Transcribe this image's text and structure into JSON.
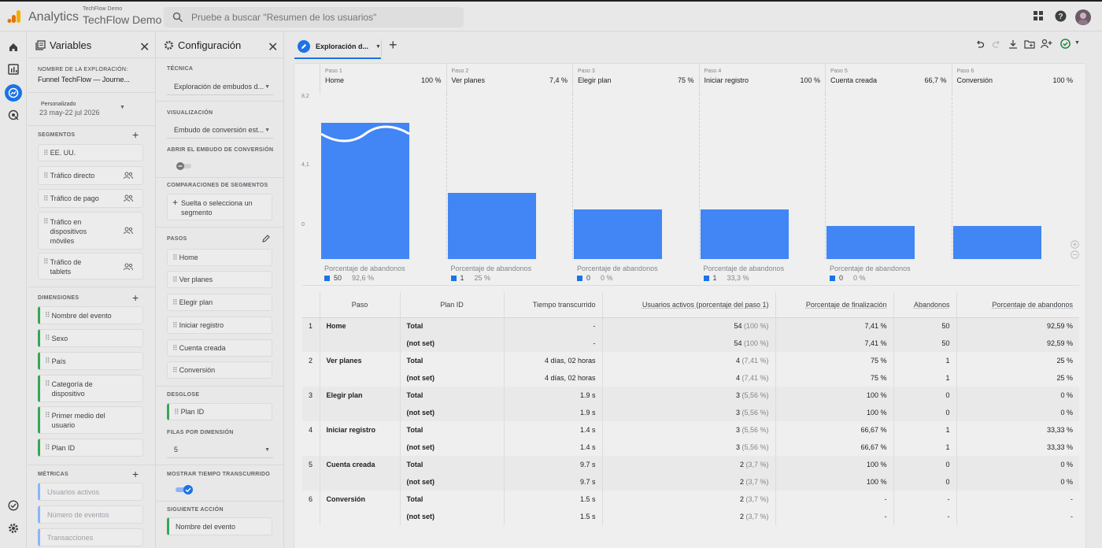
{
  "app": {
    "name": "Analytics",
    "account_sub": "TechFlow Demo",
    "account_main": "TechFlow Demo",
    "search_placeholder": "Pruebe a buscar \"Resumen de los usuarios\""
  },
  "variables": {
    "title": "Variables",
    "exploration_name_label": "NOMBRE DE LA EXPLORACIÓN:",
    "exploration_name": "Funnel TechFlow — Journe...",
    "date_label": "Personalizado",
    "date_range": "23 may-22 jul 2026",
    "segments_label": "SEGMENTOS",
    "segments": [
      "EE. UU.",
      "Tráfico directo",
      "Tráfico de pago",
      "Tráfico en dispositivos móviles",
      "Tráfico de tablets"
    ],
    "dimensions_label": "DIMENSIONES",
    "dimensions": [
      "Nombre del evento",
      "Sexo",
      "País",
      "Categoría de dispositivo",
      "Primer medio del usuario",
      "Plan ID"
    ],
    "metrics_label": "MÉTRICAS",
    "metrics": [
      "Usuarios activos",
      "Número de eventos",
      "Transacciones"
    ]
  },
  "config": {
    "title": "Configuración",
    "technique_label": "TÉCNICA",
    "technique": "Exploración de embudos d...",
    "viz_label": "VISUALIZACIÓN",
    "viz": "Embudo de conversión est...",
    "open_funnel_label": "ABRIR EL EMBUDO DE CONVERSIÓN",
    "open_funnel": false,
    "segment_compare_label": "COMPARACIONES DE SEGMENTOS",
    "segment_drop": "Suelta o selecciona un segmento",
    "steps_label": "PASOS",
    "steps": [
      "Home",
      "Ver planes",
      "Elegir plan",
      "Iniciar registro",
      "Cuenta creada",
      "Conversión"
    ],
    "breakdown_label": "DESGLOSE",
    "breakdown": "Plan ID",
    "rows_label": "FILAS POR DIMENSIÓN",
    "rows": "5",
    "elapsed_label": "MOSTRAR TIEMPO TRANSCURRIDO",
    "elapsed": true,
    "next_action_label": "SIGUIENTE ACCIÓN",
    "next_action": "Nombre del evento"
  },
  "tab": {
    "label": "Exploración d..."
  },
  "funnel": {
    "ymax_label": "8,2",
    "ymid_label": "4,1",
    "yzero_label": "0",
    "abandon_label": "Porcentaje de abandonos",
    "steps": [
      {
        "n": "Paso 1",
        "name": "Home",
        "pct": "100 %",
        "value": 54,
        "ab": "50",
        "abp": "92,6 %"
      },
      {
        "n": "Paso 2",
        "name": "Ver planes",
        "pct": "7,4 %",
        "value": 4,
        "ab": "1",
        "abp": "25 %"
      },
      {
        "n": "Paso 3",
        "name": "Elegir plan",
        "pct": "75 %",
        "value": 3,
        "ab": "0",
        "abp": "0 %"
      },
      {
        "n": "Paso 4",
        "name": "Iniciar registro",
        "pct": "100 %",
        "value": 3,
        "ab": "1",
        "abp": "33,3 %"
      },
      {
        "n": "Paso 5",
        "name": "Cuenta creada",
        "pct": "66,7 %",
        "value": 2,
        "ab": "0",
        "abp": "0 %"
      },
      {
        "n": "Paso 6",
        "name": "Conversión",
        "pct": "100 %",
        "value": 2,
        "ab": "",
        "abp": ""
      }
    ]
  },
  "table": {
    "headers": [
      "Paso",
      "Plan ID",
      "Tiempo transcurrido",
      "Usuarios activos (porcentaje del paso 1)",
      "Porcentaje de finalización",
      "Abandonos",
      "Porcentaje de abandonos"
    ],
    "rows": [
      {
        "num": "1",
        "step": "Home",
        "plan": "Total",
        "time": "-",
        "users": "54",
        "users_pct": "(100 %)",
        "fin": "7,41 %",
        "ab": "50",
        "abp": "92,59 %"
      },
      {
        "num": "",
        "step": "",
        "plan": "(not set)",
        "time": "-",
        "users": "54",
        "users_pct": "(100 %)",
        "fin": "7,41 %",
        "ab": "50",
        "abp": "92,59 %"
      },
      {
        "num": "2",
        "step": "Ver planes",
        "plan": "Total",
        "time": "4 días, 02 horas",
        "users": "4",
        "users_pct": "(7,41 %)",
        "fin": "75 %",
        "ab": "1",
        "abp": "25 %"
      },
      {
        "num": "",
        "step": "",
        "plan": "(not set)",
        "time": "4 días, 02 horas",
        "users": "4",
        "users_pct": "(7,41 %)",
        "fin": "75 %",
        "ab": "1",
        "abp": "25 %"
      },
      {
        "num": "3",
        "step": "Elegir plan",
        "plan": "Total",
        "time": "1.9 s",
        "users": "3",
        "users_pct": "(5,56 %)",
        "fin": "100 %",
        "ab": "0",
        "abp": "0 %"
      },
      {
        "num": "",
        "step": "",
        "plan": "(not set)",
        "time": "1.9 s",
        "users": "3",
        "users_pct": "(5,56 %)",
        "fin": "100 %",
        "ab": "0",
        "abp": "0 %"
      },
      {
        "num": "4",
        "step": "Iniciar registro",
        "plan": "Total",
        "time": "1.4 s",
        "users": "3",
        "users_pct": "(5,56 %)",
        "fin": "66,67 %",
        "ab": "1",
        "abp": "33,33 %"
      },
      {
        "num": "",
        "step": "",
        "plan": "(not set)",
        "time": "1.4 s",
        "users": "3",
        "users_pct": "(5,56 %)",
        "fin": "66,67 %",
        "ab": "1",
        "abp": "33,33 %"
      },
      {
        "num": "5",
        "step": "Cuenta creada",
        "plan": "Total",
        "time": "9.7 s",
        "users": "2",
        "users_pct": "(3,7 %)",
        "fin": "100 %",
        "ab": "0",
        "abp": "0 %"
      },
      {
        "num": "",
        "step": "",
        "plan": "(not set)",
        "time": "9.7 s",
        "users": "2",
        "users_pct": "(3,7 %)",
        "fin": "100 %",
        "ab": "0",
        "abp": "0 %"
      },
      {
        "num": "6",
        "step": "Conversión",
        "plan": "Total",
        "time": "1.5 s",
        "users": "2",
        "users_pct": "(3,7 %)",
        "fin": "-",
        "ab": "-",
        "abp": "-"
      },
      {
        "num": "",
        "step": "",
        "plan": "(not set)",
        "time": "1.5 s",
        "users": "2",
        "users_pct": "(3,7 %)",
        "fin": "-",
        "ab": "-",
        "abp": "-"
      }
    ]
  },
  "colors": {
    "accent": "#1a73e8",
    "bar": "#4285f4",
    "logo_orange": "#f9ab00",
    "logo_dark": "#e37400"
  }
}
